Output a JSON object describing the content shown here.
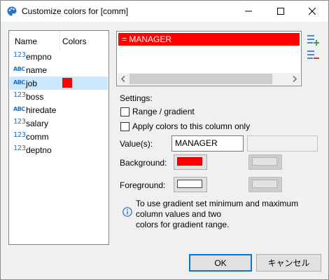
{
  "window": {
    "title": "Customize colors for [comm]",
    "icons": {
      "app": "palette-icon",
      "minimize": "minimize-icon",
      "maximize": "maximize-icon",
      "close": "close-icon"
    }
  },
  "columns_panel": {
    "header_name": "Name",
    "header_colors": "Colors",
    "rows": [
      {
        "type_icon": "123",
        "name": "empno"
      },
      {
        "type_icon": "ABC",
        "name": "name"
      },
      {
        "type_icon": "ABC",
        "name": "job",
        "color": "#ff0000",
        "selected": true
      },
      {
        "type_icon": "123",
        "name": "boss"
      },
      {
        "type_icon": "ABC",
        "name": "hiredate"
      },
      {
        "type_icon": "123",
        "name": "salary"
      },
      {
        "type_icon": "123",
        "name": "comm"
      },
      {
        "type_icon": "123",
        "name": "deptno"
      }
    ]
  },
  "rules_list": {
    "items": [
      {
        "label": "= MANAGER",
        "color": "#ff0000"
      }
    ],
    "icons": {
      "add": "add-rule-icon",
      "remove": "remove-rule-icon",
      "scroll_left": "chevron-left-icon",
      "scroll_right": "chevron-right-icon"
    }
  },
  "settings": {
    "heading": "Settings:",
    "range_label": "Range / gradient",
    "range_checked": false,
    "apply_label": "Apply colors to this column only",
    "apply_checked": false,
    "values_label": "Value(s):",
    "value1": "MANAGER",
    "value2": "",
    "background_label": "Background:",
    "background_color": "#ff0000",
    "foreground_label": "Foreground:",
    "foreground_color": "#ffffff",
    "info_line1": "To use gradient set minimum and maximum",
    "info_line2": "column values and two",
    "info_line3": "colors for gradient range."
  },
  "buttons": {
    "ok": "OK",
    "cancel": "キャンセル"
  }
}
